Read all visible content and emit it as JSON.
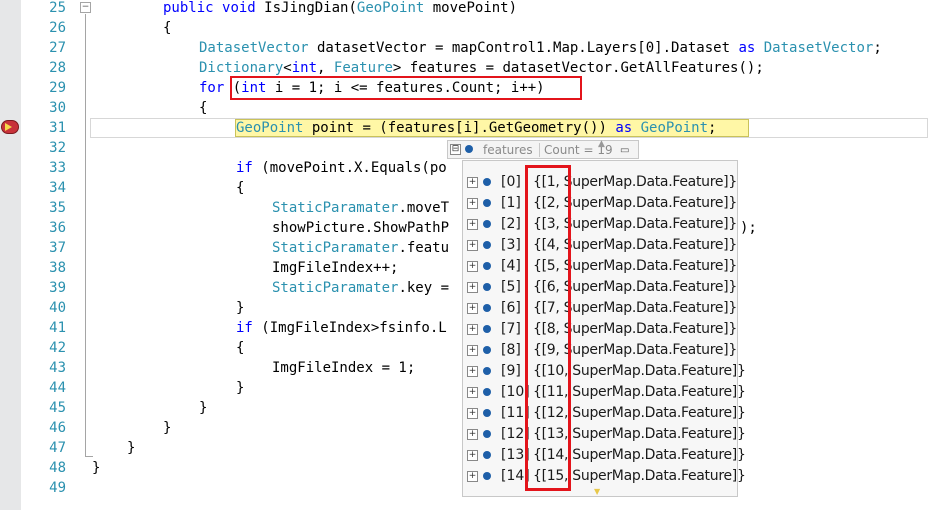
{
  "editor": {
    "line_numbers": [
      "25",
      "26",
      "27",
      "28",
      "29",
      "30",
      "31",
      "32",
      "33",
      "34",
      "35",
      "36",
      "37",
      "38",
      "39",
      "40",
      "41",
      "42",
      "43",
      "44",
      "45",
      "46",
      "47",
      "48",
      "49"
    ],
    "code": {
      "l25_kw1": "public",
      "l25_kw2": "void",
      "l25_name": "IsJingDian(",
      "l25_type": "GeoPoint",
      "l25_rest": " movePoint)",
      "l26": "{",
      "l27_type": "DatasetVector",
      "l27_mid": " datasetVector = mapControl1.Map.Layers[0].Dataset ",
      "l27_kw": "as",
      "l27_type2": "DatasetVector",
      "l27_end": ";",
      "l28_type": "Dictionary",
      "l28_lt": "<",
      "l28_kw": "int",
      "l28_comma": ", ",
      "l28_type2": "Feature",
      "l28_rest": "> features = datasetVector.GetAllFeatures();",
      "l29_kw": "for",
      "l29_p1": " (",
      "l29_kw2": "int",
      "l29_rest": " i = 1; i <= features.Count; i++)",
      "l30": "{",
      "l31_type": "GeoPoint",
      "l31_mid": " point = (features[i].GetGeometry()) ",
      "l31_kw": "as",
      "l31_sp": " ",
      "l31_type2": "GeoPoint",
      "l31_end": ";",
      "l33_kw": "if",
      "l33_rest": " (movePoint.X.Equals(po",
      "l34": "{",
      "l35_type": "StaticParamater",
      "l35_rest": ".moveT",
      "l36": "showPicture.ShowPathP",
      "l36_tail": ");",
      "l37_type": "StaticParamater",
      "l37_rest": ".featu",
      "l38": "ImgFileIndex++;",
      "l39_type": "StaticParamater",
      "l39_rest": ".key =",
      "l40": "}",
      "l41_kw": "if",
      "l41_rest": " (ImgFileIndex>fsinfo.L",
      "l42": "{",
      "l43": "ImgFileIndex = 1;",
      "l44": "}",
      "l45": "}",
      "l46": "}",
      "l47": "}",
      "l48": "}"
    }
  },
  "datatip": {
    "name": "features",
    "count": "Count = 19",
    "collapse_glyph": "⊟",
    "pin_glyph": "▭"
  },
  "popup": {
    "expand_glyph": "+",
    "items": [
      {
        "index": "[0]",
        "value": "{[1, SuperMap.Data.Feature]}"
      },
      {
        "index": "[1]",
        "value": "{[2, SuperMap.Data.Feature]}"
      },
      {
        "index": "[2]",
        "value": "{[3, SuperMap.Data.Feature]}"
      },
      {
        "index": "[3]",
        "value": "{[4, SuperMap.Data.Feature]}"
      },
      {
        "index": "[4]",
        "value": "{[5, SuperMap.Data.Feature]}"
      },
      {
        "index": "[5]",
        "value": "{[6, SuperMap.Data.Feature]}"
      },
      {
        "index": "[6]",
        "value": "{[7, SuperMap.Data.Feature]}"
      },
      {
        "index": "[7]",
        "value": "{[8, SuperMap.Data.Feature]}"
      },
      {
        "index": "[8]",
        "value": "{[9, SuperMap.Data.Feature]}"
      },
      {
        "index": "[9]",
        "value": "{[10, SuperMap.Data.Feature]}"
      },
      {
        "index": "[10]",
        "value": "{[11, SuperMap.Data.Feature]}"
      },
      {
        "index": "[11]",
        "value": "{[12, SuperMap.Data.Feature]}"
      },
      {
        "index": "[12]",
        "value": "{[13, SuperMap.Data.Feature]}"
      },
      {
        "index": "[13]",
        "value": "{[14, SuperMap.Data.Feature]}"
      },
      {
        "index": "[14]",
        "value": "{[15, SuperMap.Data.Feature]}"
      }
    ]
  },
  "colors": {
    "keyword": "#0000ff",
    "type": "#2b91af",
    "highlight": "#fff7a6",
    "annotation": "#e3141b"
  }
}
